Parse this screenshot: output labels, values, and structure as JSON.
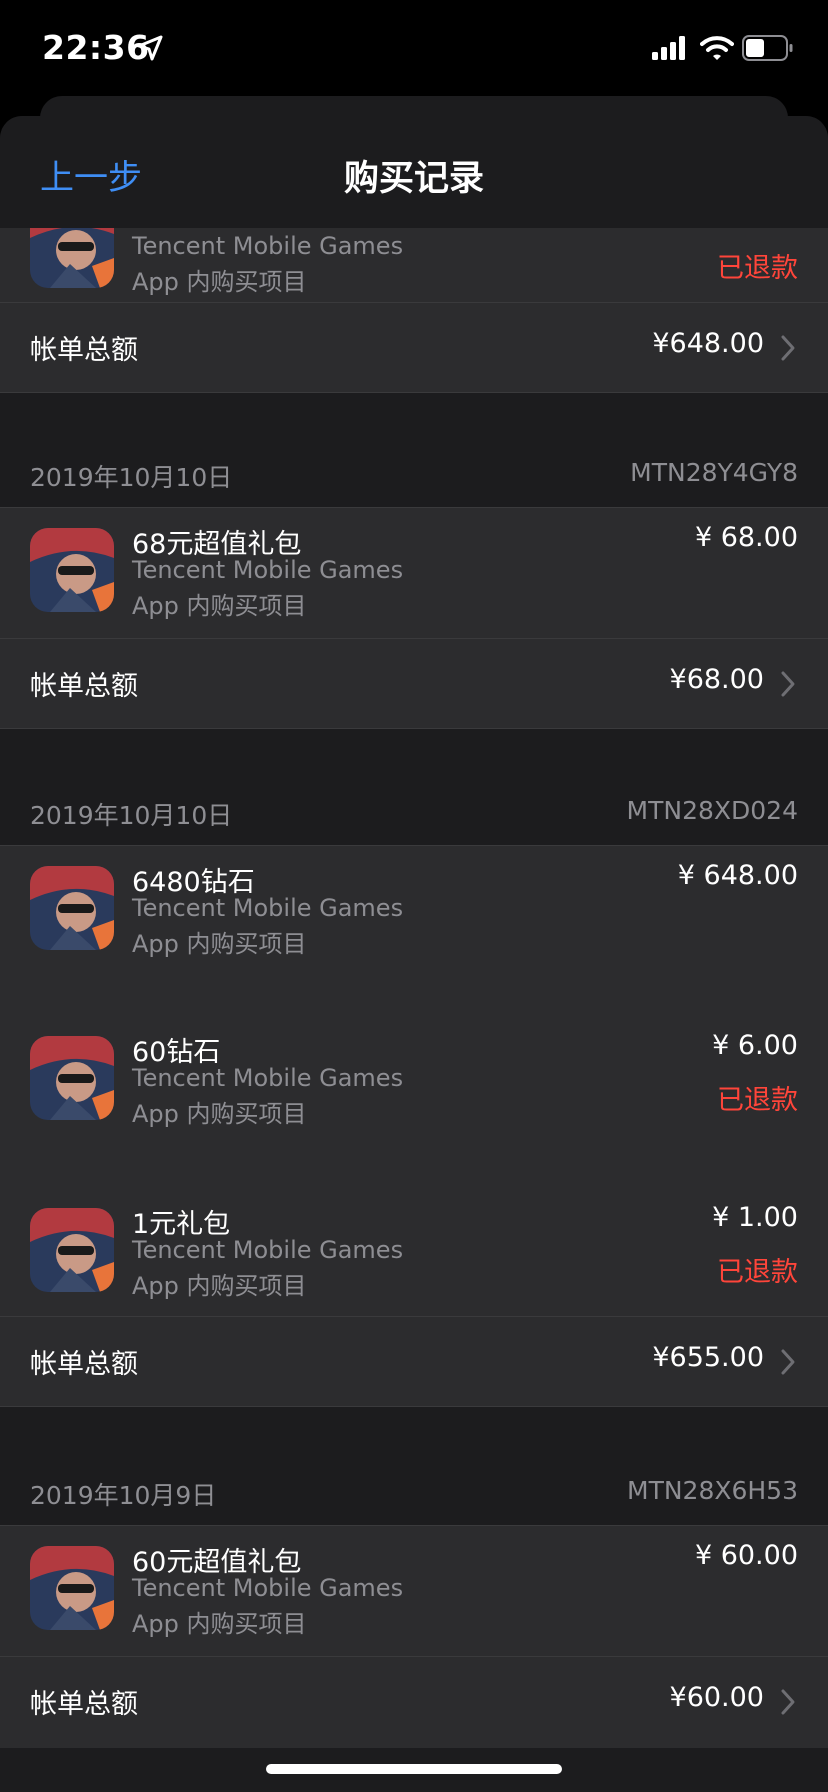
{
  "status": {
    "time": "22:36"
  },
  "nav": {
    "back_label": "上一步",
    "title": "购买记录"
  },
  "groups": [
    {
      "items": [
        {
          "name": "",
          "developer": "Tencent Mobile Games",
          "type": "App 内购买项目",
          "price": "",
          "refund": "已退款"
        }
      ],
      "total_label": "帐单总额",
      "total_amount": "¥648.00"
    },
    {
      "date": "2019年10月10日",
      "order_id": "MTN28Y4GY8",
      "items": [
        {
          "name": "68元超值礼包",
          "developer": "Tencent Mobile Games",
          "type": "App 内购买项目",
          "price": "¥ 68.00",
          "refund": ""
        }
      ],
      "total_label": "帐单总额",
      "total_amount": "¥68.00"
    },
    {
      "date": "2019年10月10日",
      "order_id": "MTN28XD024",
      "items": [
        {
          "name": "6480钻石",
          "developer": "Tencent Mobile Games",
          "type": "App 内购买项目",
          "price": "¥ 648.00",
          "refund": ""
        },
        {
          "name": "60钻石",
          "developer": "Tencent Mobile Games",
          "type": "App 内购买项目",
          "price": "¥ 6.00",
          "refund": "已退款"
        },
        {
          "name": "1元礼包",
          "developer": "Tencent Mobile Games",
          "type": "App 内购买项目",
          "price": "¥ 1.00",
          "refund": "已退款"
        }
      ],
      "total_label": "帐单总额",
      "total_amount": "¥655.00"
    },
    {
      "date": "2019年10月9日",
      "order_id": "MTN28X6H53",
      "items": [
        {
          "name": "60元超值礼包",
          "developer": "Tencent Mobile Games",
          "type": "App 内购买项目",
          "price": "¥ 60.00",
          "refund": ""
        }
      ],
      "total_label": "帐单总额",
      "total_amount": "¥60.00"
    }
  ],
  "colors": {
    "accent": "#3f8ef5",
    "refund": "#ff453a",
    "secondary_text": "#8e8e93",
    "cell_bg": "#2c2c2e",
    "grouped_bg": "#1c1c1e"
  },
  "icons": {
    "location": "location-arrow-icon",
    "signal": "cellular-signal-icon",
    "wifi": "wifi-icon",
    "battery": "battery-icon",
    "chevron": "chevron-right-icon",
    "app": "game-app-icon"
  }
}
